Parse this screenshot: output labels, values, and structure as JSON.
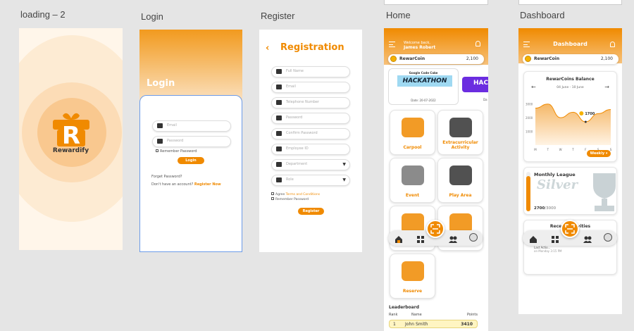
{
  "frames": {
    "loading": "loading – 2",
    "login": "Login",
    "register": "Register",
    "home": "Home",
    "dashboard": "Dashboard"
  },
  "loading": {
    "brand": "Rewardify"
  },
  "login": {
    "title": "Login",
    "email_placeholder": "Email",
    "password_placeholder": "Password",
    "remember": "Remember Password",
    "button": "Login",
    "forgot": "Forget Password?",
    "no_account": "Don't have an account?",
    "register_link": "Register Now"
  },
  "register": {
    "title": "Registration",
    "fields": [
      "Full Name",
      "Email",
      "Telephone Number",
      "Password",
      "Confirm Password",
      "Employee ID",
      "Department",
      "Role"
    ],
    "agree_prefix": "Agree",
    "agree_link": "Terms and Conditions",
    "remember": "Remember Password",
    "button": "Register"
  },
  "home": {
    "welcome": "Welcome back,",
    "user": "James Robert",
    "coin_label": "RewarCoin",
    "coin_value": "2,100",
    "banner_top": "Google Code Cake",
    "banner_title": "HACKATHON",
    "banner_date": "Date: 20-07-2022",
    "banner2_title": "HAC",
    "banner2_date": "Da",
    "tiles": [
      "Carpool",
      "Extracurricular Activity",
      "Event",
      "Play Area",
      "",
      "",
      "Reserve"
    ],
    "leaderboard_title": "Leaderboard",
    "leaderboard_cols": [
      "Rank",
      "Name",
      "Points"
    ],
    "leaderboard_rows": [
      {
        "rank": "1",
        "name": "John Smith",
        "points": "3410"
      }
    ]
  },
  "dashboard": {
    "title": "Dashboard",
    "coin_label": "RewarCoin",
    "coin_value": "2,100",
    "balance_title": "RewarCoins Balance",
    "date_range": "04 June - 10 June",
    "tooltip": "1700",
    "period": "Weekly",
    "league_title": "Monthly League",
    "league_tier": "Silver",
    "progress_value": "2700",
    "progress_max": "/3000",
    "progress_fraction": 0.9,
    "recent_title": "Recent Activities",
    "recent_item": "Last Actio...",
    "recent_date": "on Monday 3:15 PM"
  },
  "chart_data": {
    "type": "area",
    "x": [
      "M",
      "T",
      "W",
      "T",
      "F",
      "S",
      "S"
    ],
    "y": [
      2700,
      3000,
      2000,
      2400,
      1700,
      2300,
      2600
    ],
    "y_ticks": [
      "3000",
      "2000",
      "1000"
    ],
    "ylim": [
      0,
      3500
    ],
    "highlight": {
      "x": "F",
      "value": 1700
    },
    "color": "#f08a00"
  }
}
